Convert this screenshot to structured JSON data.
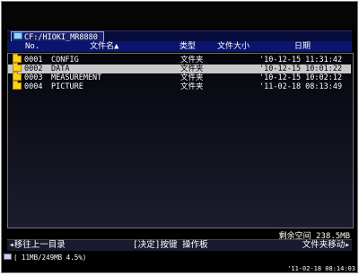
{
  "path": {
    "label": "CF:/HIOKI_MR8880",
    "icon": "cf-card-icon"
  },
  "columns": {
    "no": "No.",
    "name": "文件名▲",
    "type": "类型",
    "size": "文件大小",
    "date": "日期"
  },
  "files": [
    {
      "no": "0001",
      "name": "CONFIG",
      "type": "文件夹",
      "size": "",
      "date": "'10-12-15 11:31:42",
      "selected": false
    },
    {
      "no": "0002",
      "name": "DATA",
      "type": "文件夹",
      "size": "",
      "date": "'10-12-15 10:01:22",
      "selected": true
    },
    {
      "no": "0003",
      "name": "MEASUREMENT",
      "type": "文件夹",
      "size": "",
      "date": "'10-12-15 10:02:12",
      "selected": false
    },
    {
      "no": "0004",
      "name": "PICTURE",
      "type": "文件夹",
      "size": "",
      "date": "'11-02-18 08:13:49",
      "selected": false
    }
  ],
  "free_space": "剩余空间 238.5MB",
  "function_bar": {
    "left": "◂移往上一目录",
    "center": "[决定]按键 操作板",
    "right": "文件夹移动▸"
  },
  "status": {
    "storage": "( 11MB/249MB  4.5%)",
    "icon": "cf-card-icon"
  },
  "clock": "'11-02-18 08:14:03",
  "colors": {
    "background": "#000000",
    "header": "#0b1570",
    "selected_row": "#c8c8c8",
    "folder": "#ffd21a"
  }
}
